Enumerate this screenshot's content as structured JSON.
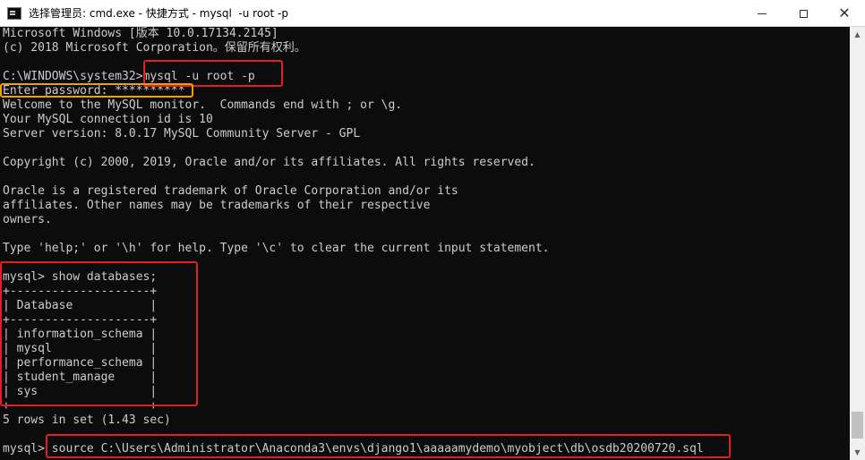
{
  "window": {
    "title": "选择管理员: cmd.exe - 快捷方式 - mysql  -u root -p",
    "minimize_glyph": "—",
    "maximize_glyph": "☐",
    "close_glyph": "✕"
  },
  "console": {
    "lines": [
      "Microsoft Windows [版本 10.0.17134.2145]",
      "(c) 2018 Microsoft Corporation。保留所有权利。",
      "",
      "C:\\WINDOWS\\system32>mysql -u root -p",
      "Enter password: **********",
      "Welcome to the MySQL monitor.  Commands end with ; or \\g.",
      "Your MySQL connection id is 10",
      "Server version: 8.0.17 MySQL Community Server - GPL",
      "",
      "Copyright (c) 2000, 2019, Oracle and/or its affiliates. All rights reserved.",
      "",
      "Oracle is a registered trademark of Oracle Corporation and/or its",
      "affiliates. Other names may be trademarks of their respective",
      "owners.",
      "",
      "Type 'help;' or '\\h' for help. Type '\\c' to clear the current input statement.",
      "",
      "mysql> show databases;",
      "+--------------------+",
      "| Database           |",
      "+--------------------+",
      "| information_schema |",
      "| mysql              |",
      "| performance_schema |",
      "| student_manage     |",
      "| sys                |",
      "+--------------------+",
      "5 rows in set (1.43 sec)",
      "",
      "mysql> source C:\\Users\\Administrator\\Anaconda3\\envs\\django1\\aaaaamydemo\\myobject\\db\\osdb20200720.sql"
    ]
  },
  "colors": {
    "console_bg": "#0c0c0c",
    "console_text": "#cccccc",
    "highlight_red": "#e02020",
    "highlight_yellow": "#f0a000"
  }
}
